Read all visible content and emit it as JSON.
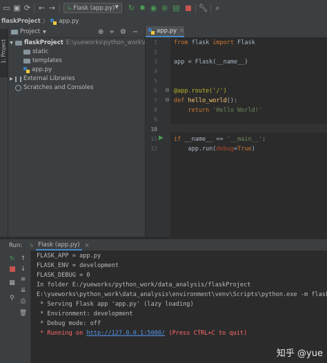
{
  "toolbar": {
    "run_config": "Flask (app.py)"
  },
  "nav": {
    "project": "flaskProject",
    "file": "app.py"
  },
  "side_strip": {
    "project_tab": "1: Project"
  },
  "project_panel": {
    "title": "Project",
    "root_name": "flaskProject",
    "root_path": "E:\\yueworks\\python_work\\data_a",
    "items": [
      "static",
      "templates",
      "app.py"
    ],
    "external": "External Libraries",
    "scratches": "Scratches and Consoles"
  },
  "editor": {
    "tab": "app.py",
    "line_numbers": [
      "1",
      "2",
      "3",
      "4",
      "5",
      "6",
      "7",
      "8",
      "9",
      "10",
      "11",
      "12"
    ],
    "code": {
      "l1_kw1": "from",
      "l1_mod": " flask ",
      "l1_kw2": "import",
      "l1_cls": " Flask",
      "l3": "app = Flask(__name__)",
      "l5": "@app.route('/')",
      "l6_kw": "def",
      "l6_fn": " hello_world",
      "l6_rest": "():",
      "l7_kw": "    return",
      "l7_str": " 'Hello World!'",
      "l11_kw": "if",
      "l11_a": " __name__ == ",
      "l11_str": "'__main__'",
      "l11_b": ":",
      "l12_a": "    app.run(",
      "l12_pm": "debug",
      "l12_b": "=",
      "l12_kw": "True",
      "l12_c": ")"
    }
  },
  "run": {
    "label": "Run:",
    "tab": "Flask (app.py)",
    "console": [
      "FLASK_APP = app.py",
      "FLASK_ENV = development",
      "FLASK_DEBUG = 0",
      "In folder E:/yueworks/python_work/data_analysis/flaskProject",
      "E:\\yueworks\\python_work\\data_analysis\\environment\\venv\\Scripts\\python.exe -m flask",
      " * Serving Flask app 'app.py' (lazy loading)",
      " * Environment: development",
      " * Debug mode: off"
    ],
    "running_prefix": " * Running on ",
    "running_url": "http://127.0.0.1:5000/",
    "running_suffix": " (Press CTRL+C to quit)"
  },
  "watermark": "知乎 @yue"
}
